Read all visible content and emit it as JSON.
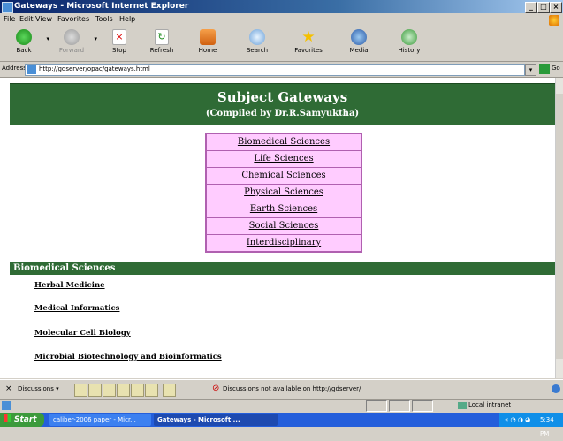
{
  "window": {
    "title": "Gateways - Microsoft Internet Explorer",
    "controls": [
      "_",
      "□",
      "×"
    ]
  },
  "menubar": [
    "File",
    "Edit",
    "View",
    "Favorites",
    "Tools",
    "Help"
  ],
  "toolbar": {
    "back": "Back",
    "forward": "Forward",
    "stop": "Stop",
    "refresh": "Refresh",
    "home": "Home",
    "search": "Search",
    "favorites": "Favorites",
    "media": "Media",
    "history": "History"
  },
  "address": {
    "label": "Address",
    "url": "http://gdserver/opac/gateways.html",
    "go": "Go"
  },
  "page": {
    "title": "Subject Gateways",
    "subtitle": "(Compiled by Dr.R.Samyuktha)",
    "subjects": [
      "Biomedical Sciences",
      "Life Sciences",
      "Chemical Sciences",
      "Physical Sciences",
      "Earth Sciences",
      "Social Sciences",
      "Interdisciplinary"
    ],
    "section_title": "Biomedical Sciences",
    "section_links": [
      "Herbal Medicine",
      "Medical Informatics",
      "Molecular Cell Biology",
      "Microbial Biotechnology and Bioinformatics"
    ]
  },
  "discussion": {
    "label": "Discussions ▾",
    "message": "Discussions not available on http://gdserver/"
  },
  "status": {
    "zone": "Local intranet"
  },
  "taskbar": {
    "start": "Start",
    "tasks": [
      "caliber-2006 paper - Micr...",
      "Gateways - Microsoft ..."
    ],
    "clock": "5:34 PM"
  },
  "colors": {
    "header_green": "#2f6b35",
    "menu_pink": "#ffccff",
    "menu_border": "#b060b0",
    "titlebar_blue": "#0a246a"
  }
}
